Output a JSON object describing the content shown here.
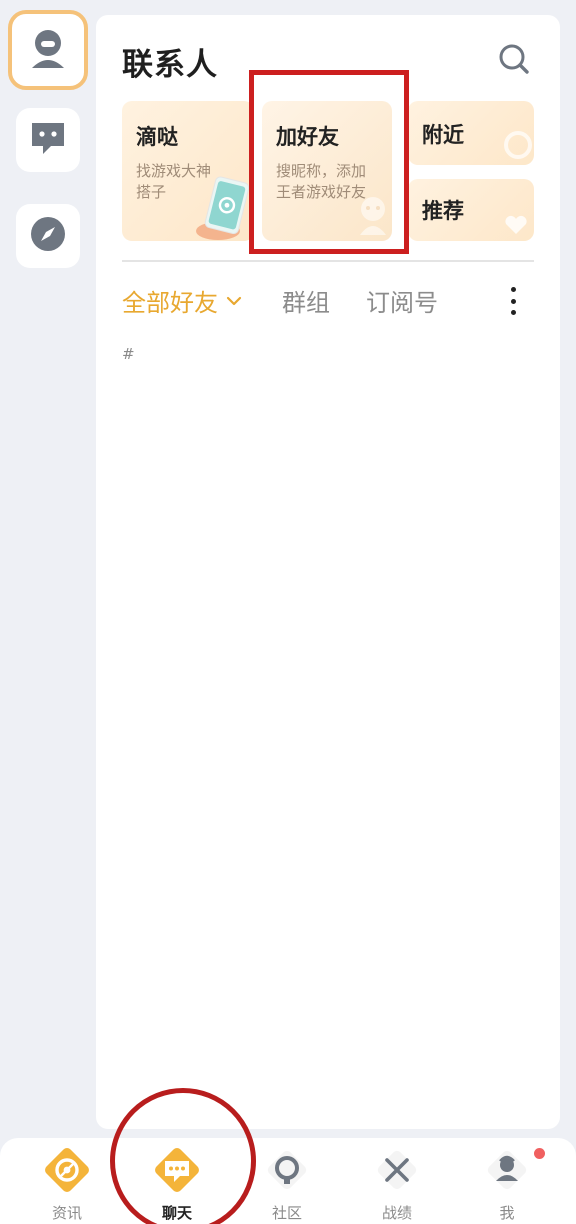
{
  "header": {
    "title": "联系人"
  },
  "cards": {
    "didi": {
      "title": "滴哒",
      "subtitle_line1": "找游戏大神",
      "subtitle_line2": "搭子"
    },
    "add_friend": {
      "title": "加好友",
      "subtitle_line1": "搜昵称，添加",
      "subtitle_line2": "王者游戏好友"
    },
    "nearby": {
      "title": "附近"
    },
    "recommend": {
      "title": "推荐"
    }
  },
  "tabs": {
    "all_friends": "全部好友",
    "groups": "群组",
    "subscriptions": "订阅号"
  },
  "list": {
    "index_letter": "#"
  },
  "bottom_nav": {
    "news": "资讯",
    "chat": "聊天",
    "community": "社区",
    "stats": "战绩",
    "me": "我"
  },
  "colors": {
    "accent": "#e8a830",
    "highlight_red": "#cc1f1f",
    "card_bg": "#fde7c9",
    "badge_red": "#f06060"
  },
  "icons": {
    "rail": [
      "contact-avatar-icon",
      "chat-bubble-icon",
      "compass-icon"
    ],
    "header": "search-icon",
    "tabs": [
      "chevron-down-icon",
      "more-vertical-icon"
    ],
    "nav": [
      "news-target-icon",
      "chat-bubble-icon",
      "community-icon",
      "crossed-swords-icon",
      "profile-icon"
    ]
  }
}
